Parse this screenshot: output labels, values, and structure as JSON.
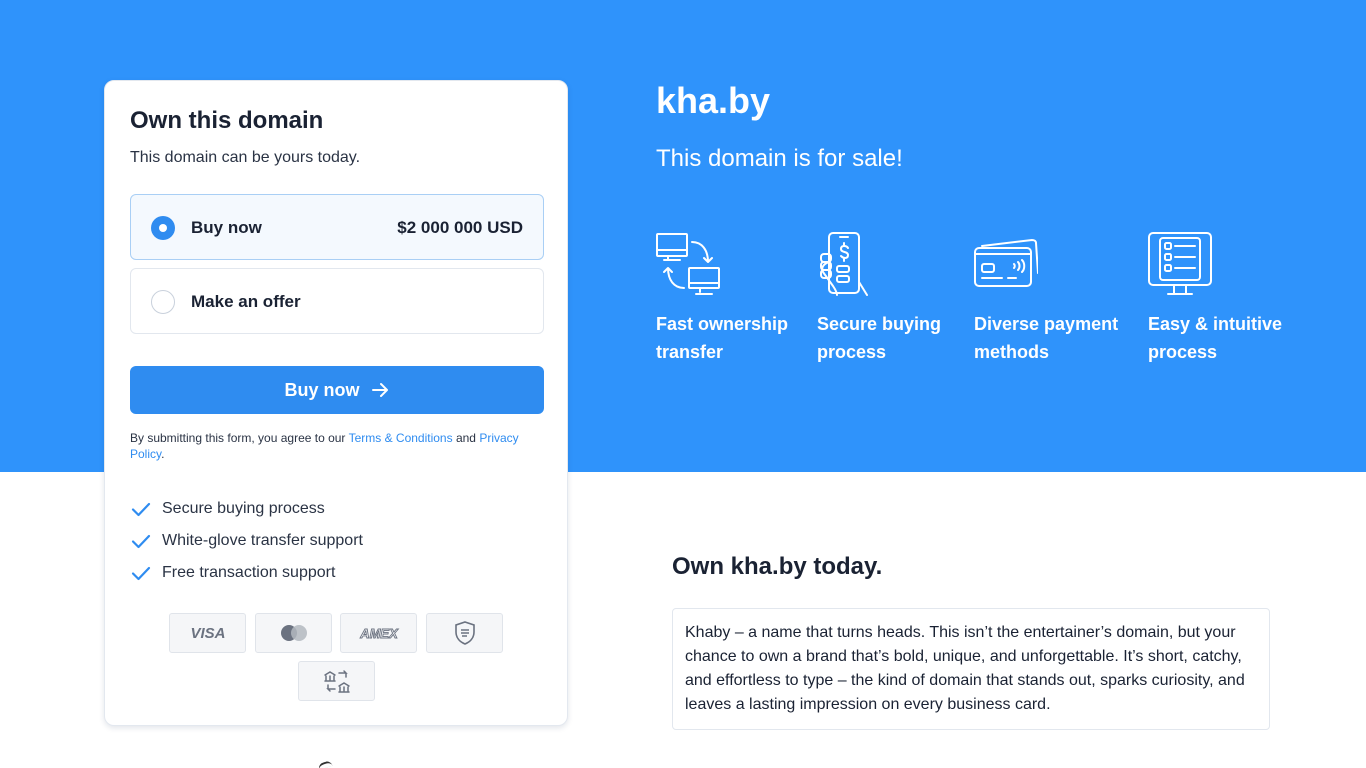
{
  "domain": "kha.by",
  "colors": {
    "hero_bg": "#2f93fb",
    "accent": "#2f8cf0",
    "text_dark": "#1a2233"
  },
  "card": {
    "title": "Own this domain",
    "subtitle": "This domain can be yours today.",
    "options": [
      {
        "label": "Buy now",
        "price": "$2 000 000 USD",
        "selected": true
      },
      {
        "label": "Make an offer",
        "selected": false
      }
    ],
    "button_label": "Buy now",
    "button_icon": "arrow-right-icon",
    "terms": {
      "prefix": "By submitting this form, you agree to our",
      "terms_link": "Terms & Conditions",
      "and": "and",
      "privacy_link": "Privacy Policy",
      "suffix": "."
    },
    "checks": [
      "Secure buying process",
      "White-glove transfer support",
      "Free transaction support"
    ],
    "payment_icons": [
      "visa-icon",
      "mastercard-icon",
      "amex-icon",
      "escrow-shield-icon",
      "bank-transfer-icon"
    ]
  },
  "hero": {
    "title": "kha.by",
    "subtitle": "This domain is for sale!",
    "features": [
      {
        "label": "Fast ownership transfer",
        "icon": "ownership-transfer-icon"
      },
      {
        "label": "Secure buying process",
        "icon": "secure-payment-phone-icon"
      },
      {
        "label": "Diverse payment methods",
        "icon": "payment-card-icon"
      },
      {
        "label": "Easy & intuitive process",
        "icon": "process-list-icon"
      }
    ]
  },
  "about": {
    "title": "Own kha.by today.",
    "description": "Khaby – a name that turns heads. This isn’t the entertainer’s domain, but your chance to own a brand that’s bold, unique, and unforgettable. It’s short, catchy, and effortless to type – the kind of domain that stands out, sparks curiosity, and leaves a lasting impression on every business card."
  }
}
